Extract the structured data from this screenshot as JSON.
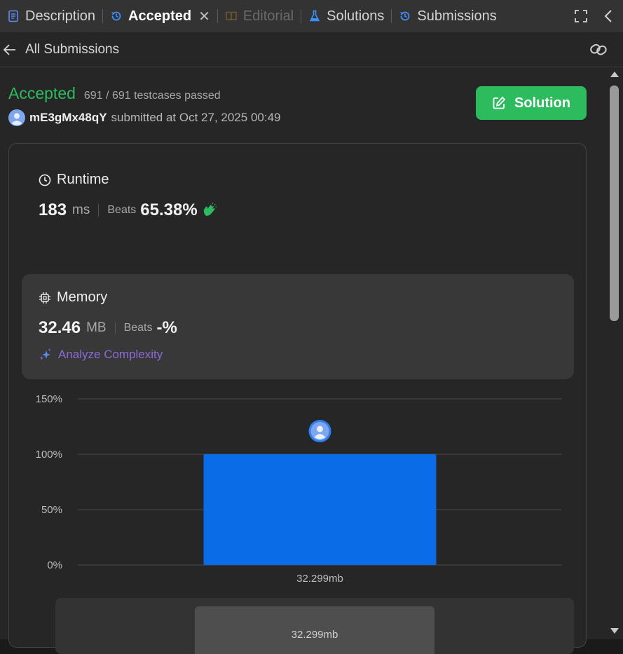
{
  "tabs": [
    {
      "label": "Description",
      "icon": "description-icon",
      "state": "normal"
    },
    {
      "label": "Accepted",
      "icon": "history-icon",
      "state": "active",
      "closable": true
    },
    {
      "label": "Editorial",
      "icon": "book-icon",
      "state": "disabled"
    },
    {
      "label": "Solutions",
      "icon": "flask-icon",
      "state": "normal"
    },
    {
      "label": "Submissions",
      "icon": "history-icon",
      "state": "normal"
    }
  ],
  "toolbar": {
    "fullscreen_icon": "fullscreen-icon",
    "collapse_icon": "chevron-left-icon"
  },
  "subheader": {
    "back_label": "All Submissions",
    "link_icon": "link-icon"
  },
  "submission": {
    "status": "Accepted",
    "testcases": "691 / 691 testcases passed",
    "username": "mE3gMx48qY",
    "submitted_text": "submitted at Oct 27, 2025 00:49",
    "solution_button": "Solution"
  },
  "runtime": {
    "title": "Runtime",
    "value": "183",
    "unit": "ms",
    "beats_label": "Beats",
    "beats_value": "65.38%"
  },
  "memory": {
    "title": "Memory",
    "value": "32.46",
    "unit": "MB",
    "beats_label": "Beats",
    "beats_value": "-%",
    "analyze_label": "Analyze Complexity"
  },
  "colors": {
    "accent_green": "#2cbb5d",
    "bar_blue": "#0a6ce6",
    "analyze_purple": "#8c6bd6"
  },
  "chart_data": {
    "type": "bar",
    "categories": [
      "32.299mb"
    ],
    "values": [
      100
    ],
    "ylim": [
      0,
      150
    ],
    "yticks": [
      "0%",
      "50%",
      "100%",
      "150%"
    ],
    "grid": true
  },
  "preview_label": "32.299mb"
}
